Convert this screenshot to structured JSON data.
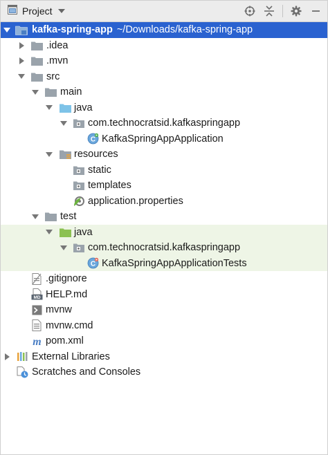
{
  "toolbar": {
    "title": "Project",
    "icons": [
      "project-view-icon",
      "chevron-down-icon",
      "locate-icon",
      "collapse-all-icon",
      "settings-gear-icon",
      "hide-icon"
    ]
  },
  "tree": {
    "root": {
      "name": "kafka-spring-app",
      "path": "~/Downloads/kafka-spring-app"
    },
    "idea": ".idea",
    "mvn": ".mvn",
    "src": "src",
    "main": "main",
    "main_java": "java",
    "main_package": "com.technocratsid.kafkaspringapp",
    "app_class": "KafkaSpringAppApplication",
    "resources": "resources",
    "static": "static",
    "templates": "templates",
    "app_properties": "application.properties",
    "test": "test",
    "test_java": "java",
    "test_package": "com.technocratsid.kafkaspringapp",
    "test_class": "KafkaSpringAppApplicationTests",
    "gitignore": ".gitignore",
    "help": "HELP.md",
    "mvnw": "mvnw",
    "mvnw_cmd": "mvnw.cmd",
    "pom": "pom.xml",
    "external_libraries": "External Libraries",
    "scratches": "Scratches and Consoles"
  },
  "colors": {
    "selection": "#2a62d0",
    "test_background": "#eef5e6",
    "folder": "#9aa3ab",
    "source_folder": "#7ec3e8",
    "test_folder": "#8cc152"
  }
}
